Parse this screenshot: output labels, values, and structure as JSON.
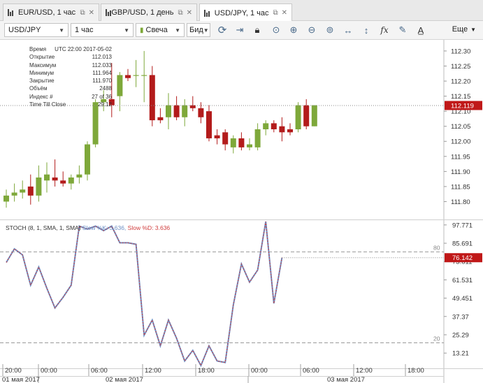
{
  "tabs": [
    {
      "label": "EUR/USD, 1 час",
      "active": false
    },
    {
      "label": "GBP/USD, 1 день",
      "active": false
    },
    {
      "label": "USD/JPY, 1 час",
      "active": true
    }
  ],
  "toolbar": {
    "symbol": "USD/JPY",
    "timeframe": "1 час",
    "chart_type": "Свеча",
    "price_type": "Бид",
    "more_label": "Еще"
  },
  "info_panel": {
    "rows": [
      {
        "key": "Время",
        "value": "UTC 22:00 2017-05-02"
      },
      {
        "key": "Открытие",
        "value": "112.013"
      },
      {
        "key": "Максимум",
        "value": "112.033"
      },
      {
        "key": "Минимум",
        "value": "111.964"
      },
      {
        "key": "Закрытие",
        "value": "111.970"
      },
      {
        "key": "Объём",
        "value": "2488"
      },
      {
        "key": "Индекс #",
        "value": "27 of 36"
      },
      {
        "key": "Time Till Close",
        "value": "29:12"
      }
    ]
  },
  "oscillator": {
    "name": "STOCH (8, 1, SMA, 1, SMA)",
    "fast_label": "Slow %K: 3.636,",
    "slow_label": "Slow %D: 3.636",
    "level_high": "80",
    "level_low": "20",
    "current_value_label": "76.142"
  },
  "price_current_label": "112.119",
  "colors": {
    "bull": "#7ea83a",
    "bear": "#b31b1b",
    "current_price_bg": "#c01818",
    "stoch_fast": "#6c8ec4",
    "stoch_slow": "#d03c3c"
  },
  "chart_data": [
    {
      "type": "candlestick",
      "title": "",
      "ylim": [
        111.75,
        112.33
      ],
      "y_ticks": [
        "112.30",
        "112.25",
        "112.20",
        "112.15",
        "112.10",
        "112.05",
        "112.00",
        "111.95",
        "111.90",
        "111.85",
        "111.80"
      ],
      "candles": [
        {
          "o": 111.8,
          "h": 111.84,
          "l": 111.78,
          "c": 111.82
        },
        {
          "o": 111.82,
          "h": 111.86,
          "l": 111.8,
          "c": 111.83
        },
        {
          "o": 111.83,
          "h": 111.87,
          "l": 111.81,
          "c": 111.84
        },
        {
          "o": 111.85,
          "h": 111.89,
          "l": 111.79,
          "c": 111.82
        },
        {
          "o": 111.82,
          "h": 111.92,
          "l": 111.8,
          "c": 111.88
        },
        {
          "o": 111.87,
          "h": 111.93,
          "l": 111.83,
          "c": 111.89
        },
        {
          "o": 111.88,
          "h": 111.94,
          "l": 111.85,
          "c": 111.87
        },
        {
          "o": 111.87,
          "h": 111.9,
          "l": 111.85,
          "c": 111.86
        },
        {
          "o": 111.86,
          "h": 111.89,
          "l": 111.84,
          "c": 111.88
        },
        {
          "o": 111.88,
          "h": 111.92,
          "l": 111.86,
          "c": 111.89
        },
        {
          "o": 111.89,
          "h": 112.0,
          "l": 111.87,
          "c": 111.99
        },
        {
          "o": 111.99,
          "h": 112.14,
          "l": 111.98,
          "c": 112.13
        },
        {
          "o": 112.13,
          "h": 112.17,
          "l": 112.1,
          "c": 112.14
        },
        {
          "o": 112.14,
          "h": 112.26,
          "l": 112.08,
          "c": 112.12
        },
        {
          "o": 112.15,
          "h": 112.23,
          "l": 112.1,
          "c": 112.22
        },
        {
          "o": 112.22,
          "h": 112.24,
          "l": 112.2,
          "c": 112.21
        },
        {
          "o": 112.22,
          "h": 112.27,
          "l": 112.18,
          "c": 112.22
        },
        {
          "o": 112.22,
          "h": 112.3,
          "l": 112.13,
          "c": 112.22
        },
        {
          "o": 112.22,
          "h": 112.25,
          "l": 112.05,
          "c": 112.07
        },
        {
          "o": 112.08,
          "h": 112.11,
          "l": 112.06,
          "c": 112.07
        },
        {
          "o": 112.08,
          "h": 112.16,
          "l": 112.04,
          "c": 112.12
        },
        {
          "o": 112.12,
          "h": 112.15,
          "l": 112.07,
          "c": 112.08
        },
        {
          "o": 112.08,
          "h": 112.14,
          "l": 112.05,
          "c": 112.12
        },
        {
          "o": 112.12,
          "h": 112.15,
          "l": 112.1,
          "c": 112.11
        },
        {
          "o": 112.11,
          "h": 112.13,
          "l": 112.06,
          "c": 112.08
        },
        {
          "o": 112.1,
          "h": 112.12,
          "l": 112.0,
          "c": 112.01
        },
        {
          "o": 112.02,
          "h": 112.04,
          "l": 111.99,
          "c": 112.01
        },
        {
          "o": 112.03,
          "h": 112.04,
          "l": 111.97,
          "c": 111.99
        },
        {
          "o": 111.98,
          "h": 112.02,
          "l": 111.96,
          "c": 112.01
        },
        {
          "o": 112.01,
          "h": 112.03,
          "l": 111.97,
          "c": 111.98
        },
        {
          "o": 111.98,
          "h": 112.01,
          "l": 111.97,
          "c": 111.99
        },
        {
          "o": 111.98,
          "h": 112.06,
          "l": 111.97,
          "c": 112.04
        },
        {
          "o": 112.04,
          "h": 112.07,
          "l": 112.02,
          "c": 112.06
        },
        {
          "o": 112.06,
          "h": 112.07,
          "l": 112.03,
          "c": 112.04
        },
        {
          "o": 112.05,
          "h": 112.08,
          "l": 112.0,
          "c": 112.03
        },
        {
          "o": 112.04,
          "h": 112.06,
          "l": 112.02,
          "c": 112.03
        },
        {
          "o": 112.04,
          "h": 112.13,
          "l": 112.03,
          "c": 112.12
        },
        {
          "o": 112.12,
          "h": 112.14,
          "l": 112.04,
          "c": 112.05
        },
        {
          "o": 112.05,
          "h": 112.12,
          "l": 112.05,
          "c": 112.12
        }
      ],
      "current_price": 112.119
    },
    {
      "type": "line",
      "title": "",
      "ylim": [
        5,
        100
      ],
      "y_ticks": [
        "97.771",
        "85.691",
        "73.611",
        "61.531",
        "49.451",
        "37.37",
        "25.29",
        "13.21"
      ],
      "levels": [
        80,
        20
      ],
      "values": [
        73,
        82,
        78,
        58,
        70,
        56,
        43,
        50,
        58,
        97,
        95,
        97,
        94,
        97,
        86,
        86,
        85,
        25,
        35,
        18,
        35,
        23,
        8,
        15,
        5,
        18,
        8,
        7,
        45,
        72,
        60,
        68,
        100,
        46,
        76.142
      ],
      "current_value": 76.142
    }
  ],
  "x_axis": {
    "time_labels": [
      "20:00",
      "00:00",
      "06:00",
      "12:00",
      "18:00",
      "00:00",
      "06:00",
      "12:00",
      "18:00"
    ],
    "date_labels": [
      "01 мая 2017",
      "02 мая 2017",
      "03 мая 2017"
    ]
  }
}
